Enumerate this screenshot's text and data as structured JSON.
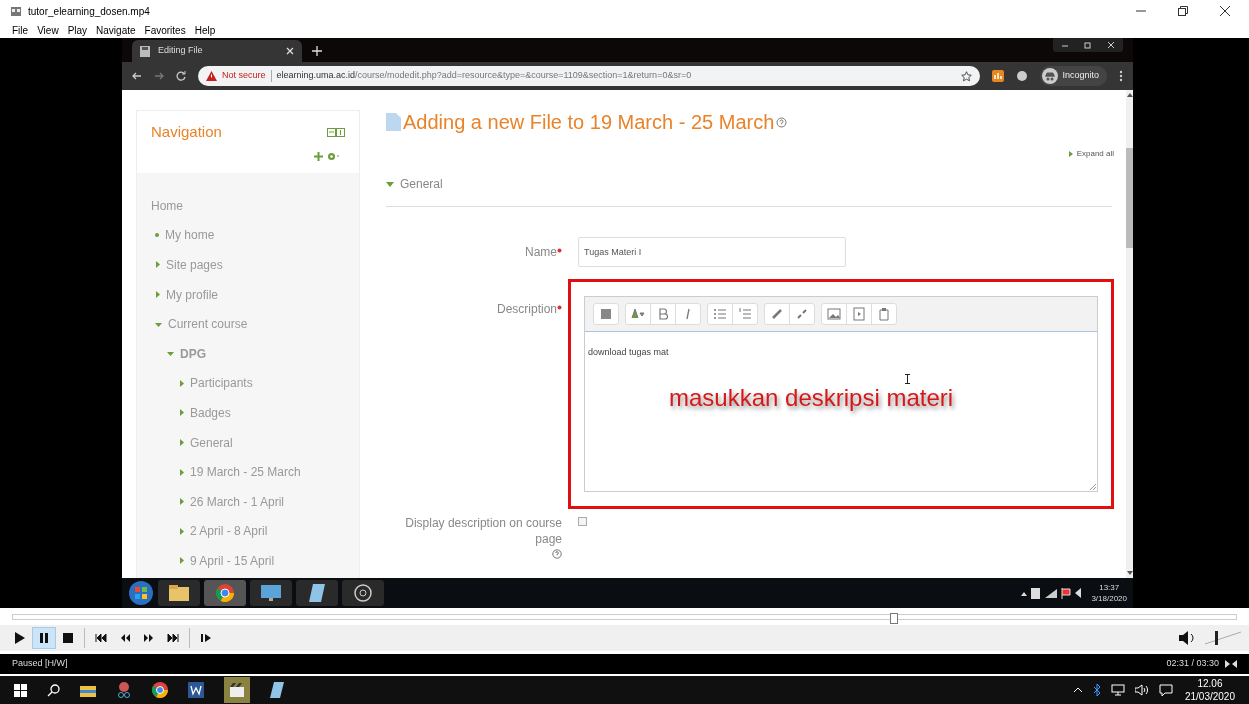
{
  "window": {
    "title": "tutor_elearning_dosen.mp4"
  },
  "menu": [
    "File",
    "View",
    "Play",
    "Navigate",
    "Favorites",
    "Help"
  ],
  "video": {
    "browser": {
      "tab_title": "Editing File",
      "security": "Not secure",
      "url_host": "elearning.uma.ac.id",
      "url_path": "/course/modedit.php?add=resource&type=&course=1109&section=1&return=0&sr=0",
      "profile": "Incognito"
    },
    "navigation": {
      "title": "Navigation",
      "items": [
        {
          "kind": "heading",
          "label": "Home",
          "children": [
            {
              "kind": "link",
              "label": "My home"
            },
            {
              "kind": "branch",
              "label": "Site pages",
              "expanded": false
            },
            {
              "kind": "branch",
              "label": "My profile",
              "expanded": false
            },
            {
              "kind": "branch",
              "label": "Current course",
              "expanded": true,
              "children": [
                {
                  "kind": "course",
                  "label": "DPG",
                  "expanded": true,
                  "children": [
                    {
                      "kind": "branch",
                      "label": "Participants",
                      "expanded": false
                    },
                    {
                      "kind": "branch",
                      "label": "Badges",
                      "expanded": false
                    },
                    {
                      "kind": "branch",
                      "label": "General",
                      "expanded": false
                    },
                    {
                      "kind": "branch",
                      "label": "19 March - 25 March",
                      "expanded": false
                    },
                    {
                      "kind": "branch",
                      "label": "26 March - 1 April",
                      "expanded": false
                    },
                    {
                      "kind": "branch",
                      "label": "2 April - 8 April",
                      "expanded": false
                    },
                    {
                      "kind": "branch",
                      "label": "9 April - 15 April",
                      "expanded": false
                    }
                  ]
                }
              ]
            }
          ]
        }
      ]
    },
    "page": {
      "heading": "Adding a new File to 19 March - 25 March",
      "expand_all": "Expand all",
      "section": {
        "label": "General",
        "expanded": true
      },
      "fields": [
        {
          "kind": "text",
          "label": "Name",
          "required": true,
          "value": "Tugas Materi I"
        },
        {
          "kind": "editor",
          "label": "Description",
          "required": true,
          "value": "download tugas mat",
          "highlighted": true
        },
        {
          "kind": "checkbox",
          "label": "Display description on course page",
          "checked": false
        }
      ]
    },
    "annotation": "masukkan deskripsi materi",
    "guest_taskbar": {
      "time": "13:37",
      "date": "3/18/2020"
    }
  },
  "player": {
    "seek": {
      "level": 0.72
    },
    "controls": [
      {
        "kind": "play",
        "selected": false
      },
      {
        "kind": "pause",
        "selected": true
      },
      {
        "kind": "stop",
        "selected": false
      },
      {
        "kind": "previous",
        "selected": false
      },
      {
        "kind": "rewind",
        "selected": false
      },
      {
        "kind": "forward",
        "selected": false
      },
      {
        "kind": "next",
        "selected": false
      },
      {
        "kind": "step",
        "selected": false
      }
    ],
    "volume": {
      "level": 0.3
    },
    "status": "Paused [H/W]",
    "time": "02:31 / 03:30"
  },
  "taskbar": {
    "time": "12.06",
    "date": "21/03/2020"
  }
}
